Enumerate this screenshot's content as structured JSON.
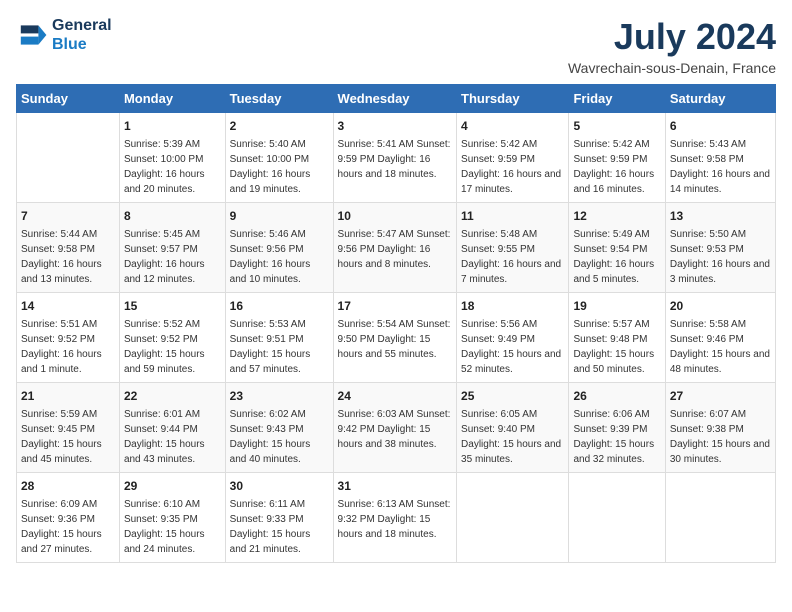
{
  "logo": {
    "line1": "General",
    "line2": "Blue"
  },
  "title": "July 2024",
  "location": "Wavrechain-sous-Denain, France",
  "weekdays": [
    "Sunday",
    "Monday",
    "Tuesday",
    "Wednesday",
    "Thursday",
    "Friday",
    "Saturday"
  ],
  "weeks": [
    [
      {
        "day": "",
        "content": ""
      },
      {
        "day": "1",
        "content": "Sunrise: 5:39 AM\nSunset: 10:00 PM\nDaylight: 16 hours\nand 20 minutes."
      },
      {
        "day": "2",
        "content": "Sunrise: 5:40 AM\nSunset: 10:00 PM\nDaylight: 16 hours\nand 19 minutes."
      },
      {
        "day": "3",
        "content": "Sunrise: 5:41 AM\nSunset: 9:59 PM\nDaylight: 16 hours\nand 18 minutes."
      },
      {
        "day": "4",
        "content": "Sunrise: 5:42 AM\nSunset: 9:59 PM\nDaylight: 16 hours\nand 17 minutes."
      },
      {
        "day": "5",
        "content": "Sunrise: 5:42 AM\nSunset: 9:59 PM\nDaylight: 16 hours\nand 16 minutes."
      },
      {
        "day": "6",
        "content": "Sunrise: 5:43 AM\nSunset: 9:58 PM\nDaylight: 16 hours\nand 14 minutes."
      }
    ],
    [
      {
        "day": "7",
        "content": "Sunrise: 5:44 AM\nSunset: 9:58 PM\nDaylight: 16 hours\nand 13 minutes."
      },
      {
        "day": "8",
        "content": "Sunrise: 5:45 AM\nSunset: 9:57 PM\nDaylight: 16 hours\nand 12 minutes."
      },
      {
        "day": "9",
        "content": "Sunrise: 5:46 AM\nSunset: 9:56 PM\nDaylight: 16 hours\nand 10 minutes."
      },
      {
        "day": "10",
        "content": "Sunrise: 5:47 AM\nSunset: 9:56 PM\nDaylight: 16 hours\nand 8 minutes."
      },
      {
        "day": "11",
        "content": "Sunrise: 5:48 AM\nSunset: 9:55 PM\nDaylight: 16 hours\nand 7 minutes."
      },
      {
        "day": "12",
        "content": "Sunrise: 5:49 AM\nSunset: 9:54 PM\nDaylight: 16 hours\nand 5 minutes."
      },
      {
        "day": "13",
        "content": "Sunrise: 5:50 AM\nSunset: 9:53 PM\nDaylight: 16 hours\nand 3 minutes."
      }
    ],
    [
      {
        "day": "14",
        "content": "Sunrise: 5:51 AM\nSunset: 9:52 PM\nDaylight: 16 hours\nand 1 minute."
      },
      {
        "day": "15",
        "content": "Sunrise: 5:52 AM\nSunset: 9:52 PM\nDaylight: 15 hours\nand 59 minutes."
      },
      {
        "day": "16",
        "content": "Sunrise: 5:53 AM\nSunset: 9:51 PM\nDaylight: 15 hours\nand 57 minutes."
      },
      {
        "day": "17",
        "content": "Sunrise: 5:54 AM\nSunset: 9:50 PM\nDaylight: 15 hours\nand 55 minutes."
      },
      {
        "day": "18",
        "content": "Sunrise: 5:56 AM\nSunset: 9:49 PM\nDaylight: 15 hours\nand 52 minutes."
      },
      {
        "day": "19",
        "content": "Sunrise: 5:57 AM\nSunset: 9:48 PM\nDaylight: 15 hours\nand 50 minutes."
      },
      {
        "day": "20",
        "content": "Sunrise: 5:58 AM\nSunset: 9:46 PM\nDaylight: 15 hours\nand 48 minutes."
      }
    ],
    [
      {
        "day": "21",
        "content": "Sunrise: 5:59 AM\nSunset: 9:45 PM\nDaylight: 15 hours\nand 45 minutes."
      },
      {
        "day": "22",
        "content": "Sunrise: 6:01 AM\nSunset: 9:44 PM\nDaylight: 15 hours\nand 43 minutes."
      },
      {
        "day": "23",
        "content": "Sunrise: 6:02 AM\nSunset: 9:43 PM\nDaylight: 15 hours\nand 40 minutes."
      },
      {
        "day": "24",
        "content": "Sunrise: 6:03 AM\nSunset: 9:42 PM\nDaylight: 15 hours\nand 38 minutes."
      },
      {
        "day": "25",
        "content": "Sunrise: 6:05 AM\nSunset: 9:40 PM\nDaylight: 15 hours\nand 35 minutes."
      },
      {
        "day": "26",
        "content": "Sunrise: 6:06 AM\nSunset: 9:39 PM\nDaylight: 15 hours\nand 32 minutes."
      },
      {
        "day": "27",
        "content": "Sunrise: 6:07 AM\nSunset: 9:38 PM\nDaylight: 15 hours\nand 30 minutes."
      }
    ],
    [
      {
        "day": "28",
        "content": "Sunrise: 6:09 AM\nSunset: 9:36 PM\nDaylight: 15 hours\nand 27 minutes."
      },
      {
        "day": "29",
        "content": "Sunrise: 6:10 AM\nSunset: 9:35 PM\nDaylight: 15 hours\nand 24 minutes."
      },
      {
        "day": "30",
        "content": "Sunrise: 6:11 AM\nSunset: 9:33 PM\nDaylight: 15 hours\nand 21 minutes."
      },
      {
        "day": "31",
        "content": "Sunrise: 6:13 AM\nSunset: 9:32 PM\nDaylight: 15 hours\nand 18 minutes."
      },
      {
        "day": "",
        "content": ""
      },
      {
        "day": "",
        "content": ""
      },
      {
        "day": "",
        "content": ""
      }
    ]
  ]
}
